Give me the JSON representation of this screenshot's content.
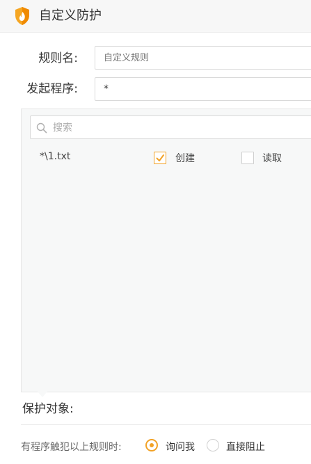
{
  "window": {
    "title": "自定义防护",
    "icon": "shield-flame-icon",
    "accent_color": "#f2a226"
  },
  "form": {
    "rule_name_label": "规则名:",
    "rule_name_placeholder": "自定义规则",
    "rule_name_value": "",
    "process_label": "发起程序:",
    "process_value": "*"
  },
  "panel": {
    "search_placeholder": "搜索",
    "rows": [
      {
        "path": "*\\1.txt",
        "create_label": "创建",
        "create_checked": true,
        "read_label": "读取",
        "read_checked": false
      }
    ]
  },
  "protect_label": "保护对象:",
  "trigger": {
    "label": "有程序触犯以上规则时:",
    "options": [
      {
        "label": "询问我",
        "selected": true
      },
      {
        "label": "直接阻止",
        "selected": false
      }
    ]
  }
}
